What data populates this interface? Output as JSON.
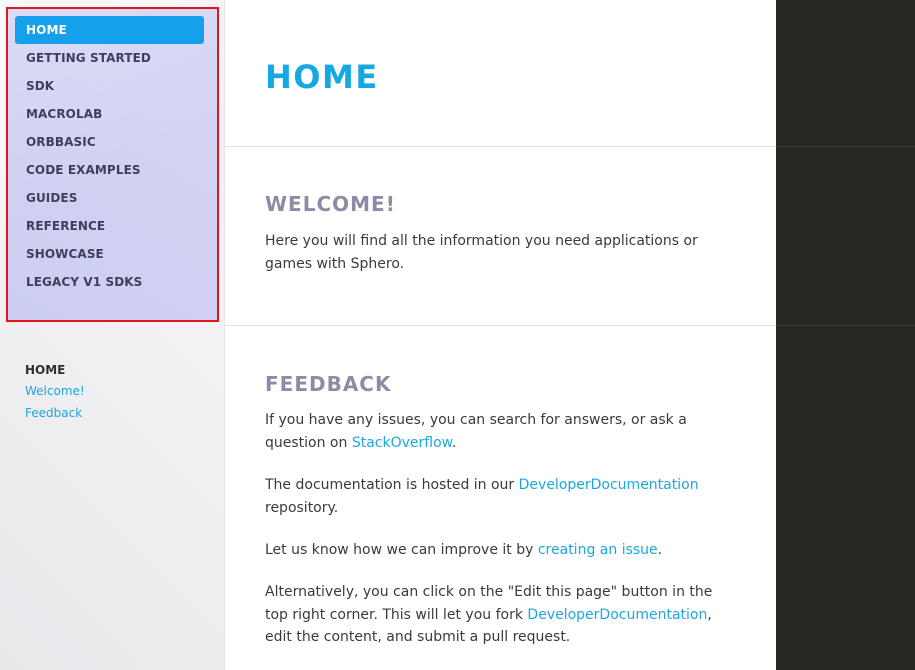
{
  "sidebar": {
    "nav": [
      {
        "label": "HOME",
        "active": true
      },
      {
        "label": "GETTING STARTED"
      },
      {
        "label": "SDK"
      },
      {
        "label": "MACROLAB"
      },
      {
        "label": "ORBBASIC"
      },
      {
        "label": "CODE EXAMPLES"
      },
      {
        "label": "GUIDES"
      },
      {
        "label": "REFERENCE"
      },
      {
        "label": "SHOWCASE"
      },
      {
        "label": "LEGACY V1 SDKS"
      }
    ],
    "toc": {
      "title": "HOME",
      "links": [
        "Welcome!",
        "Feedback"
      ]
    }
  },
  "main": {
    "title": "HOME",
    "welcome": {
      "heading": "WELCOME!",
      "text": "Here you will find all the information you need applications or games with Sphero."
    },
    "feedback": {
      "heading": "FEEDBACK",
      "p1_before": "If you have any issues, you can search for answers, or ask a question on ",
      "p1_link": "StackOverflow",
      "p1_after": ".",
      "p2_before": "The documentation is hosted in our ",
      "p2_link": "DeveloperDocumentation",
      "p2_after": " repository.",
      "p3_before": "Let us know how we can improve it by ",
      "p3_link": "creating an issue",
      "p3_after": ".",
      "p4_before": "Alternatively, you can click on the \"Edit this page\" button in the top right corner. This will let you fork ",
      "p4_link": "DeveloperDocumentation",
      "p4_after": ", edit the content, and submit a pull request."
    }
  },
  "colors": {
    "accent": "#14a0ea",
    "heading": "#8d8ca6",
    "link": "#1ea6e0",
    "dark_panel": "#272622"
  }
}
